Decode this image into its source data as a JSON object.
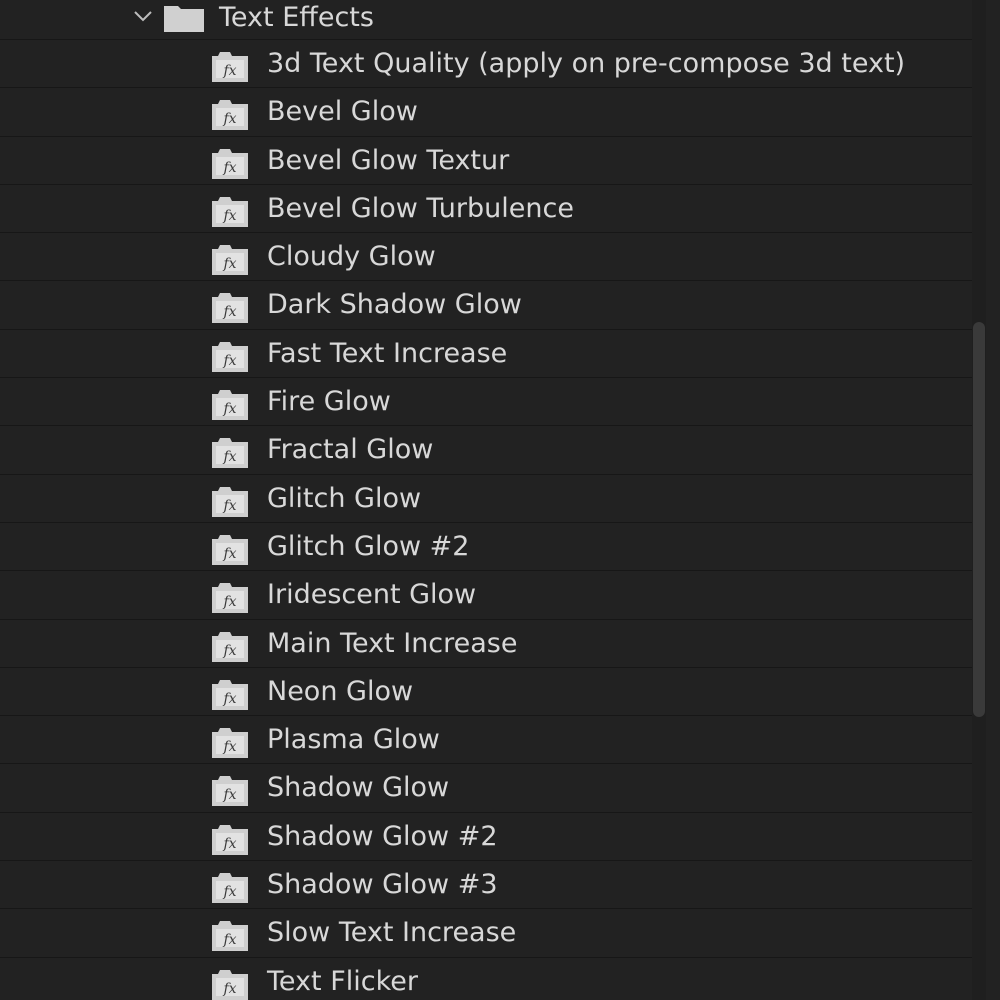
{
  "folder": {
    "label": "Text Effects",
    "expanded": true,
    "chevron_icon": "chevron-down-icon",
    "folder_icon": "folder-icon"
  },
  "effects": {
    "icon": "fx-preset-icon",
    "items": [
      {
        "label": "3d Text Quality (apply on pre-compose 3d text)"
      },
      {
        "label": "Bevel Glow"
      },
      {
        "label": "Bevel Glow Textur"
      },
      {
        "label": "Bevel Glow Turbulence"
      },
      {
        "label": "Cloudy Glow"
      },
      {
        "label": "Dark Shadow Glow"
      },
      {
        "label": "Fast Text Increase"
      },
      {
        "label": "Fire Glow"
      },
      {
        "label": "Fractal Glow"
      },
      {
        "label": "Glitch Glow"
      },
      {
        "label": "Glitch Glow #2"
      },
      {
        "label": "Iridescent Glow"
      },
      {
        "label": "Main Text Increase"
      },
      {
        "label": "Neon Glow"
      },
      {
        "label": "Plasma Glow"
      },
      {
        "label": "Shadow Glow"
      },
      {
        "label": "Shadow Glow #2"
      },
      {
        "label": "Shadow Glow #3"
      },
      {
        "label": "Slow Text Increase"
      },
      {
        "label": "Text Flicker"
      }
    ]
  },
  "colors": {
    "background": "#222222",
    "row_divider": "#171717",
    "text": "#d8d8d8",
    "icon": "#cfcfcf",
    "scroll_thumb": "#3a3a3a"
  }
}
